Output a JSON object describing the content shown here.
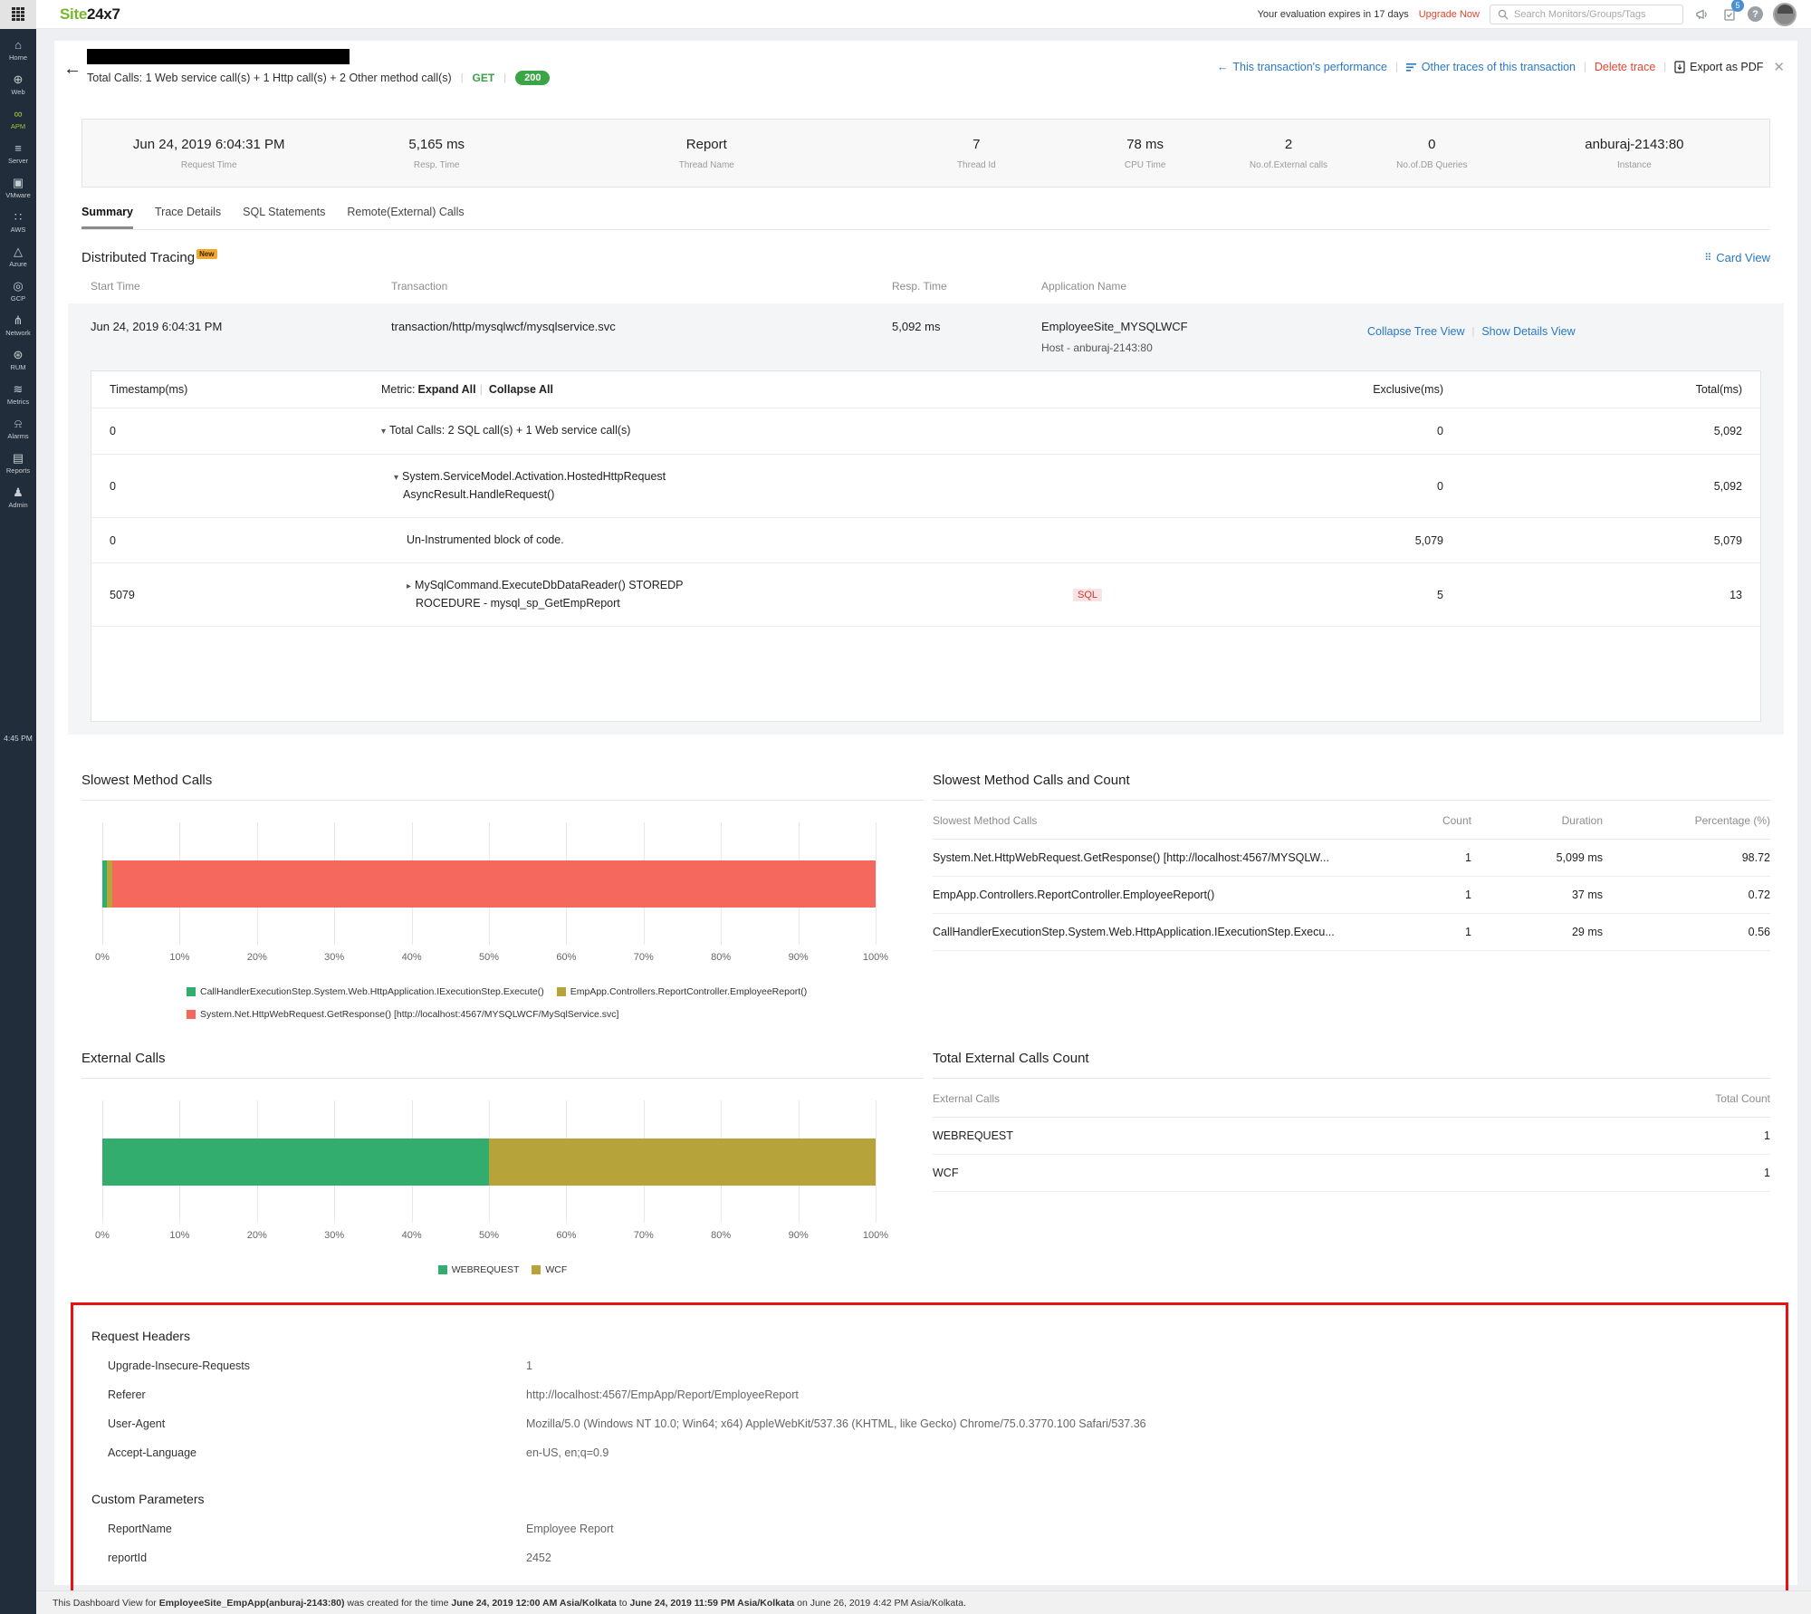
{
  "topbar": {
    "logo_site": "Site",
    "logo_rest": "24x7",
    "evaluation_text": "Your evaluation expires in 17 days",
    "upgrade_label": "Upgrade Now",
    "search_placeholder": "Search Monitors/Groups/Tags",
    "notification_count": "5"
  },
  "sidebar": {
    "time": "4:45 PM",
    "items": [
      {
        "label": "Home",
        "icon": "home-icon",
        "active": false
      },
      {
        "label": "Web",
        "icon": "web-icon",
        "active": false
      },
      {
        "label": "APM",
        "icon": "apm-icon",
        "active": true
      },
      {
        "label": "Server",
        "icon": "server-icon",
        "active": false
      },
      {
        "label": "VMware",
        "icon": "vmware-icon",
        "active": false
      },
      {
        "label": "AWS",
        "icon": "aws-icon",
        "active": false
      },
      {
        "label": "Azure",
        "icon": "azure-icon",
        "active": false
      },
      {
        "label": "GCP",
        "icon": "gcp-icon",
        "active": false
      },
      {
        "label": "Network",
        "icon": "network-icon",
        "active": false
      },
      {
        "label": "RUM",
        "icon": "rum-icon",
        "active": false
      },
      {
        "label": "Metrics",
        "icon": "metrics-icon",
        "active": false
      },
      {
        "label": "Alarms",
        "icon": "alarms-icon",
        "active": false
      },
      {
        "label": "Reports",
        "icon": "reports-icon",
        "active": false
      },
      {
        "label": "Admin",
        "icon": "admin-icon",
        "active": false
      }
    ]
  },
  "header": {
    "total_calls": "Total Calls: 1 Web service call(s) + 1 Http call(s) + 2 Other method call(s)",
    "method": "GET",
    "status_code": "200",
    "links": {
      "performance": "This transaction's performance",
      "other_traces": "Other traces of this transaction",
      "delete_trace": "Delete trace",
      "export_pdf": "Export as PDF"
    }
  },
  "stats": [
    {
      "value": "Jun 24, 2019 6:04:31 PM",
      "label": "Request Time"
    },
    {
      "value": "5,165 ms",
      "label": "Resp. Time"
    },
    {
      "value": "Report",
      "label": "Thread Name"
    },
    {
      "value": "7",
      "label": "Thread Id"
    },
    {
      "value": "78 ms",
      "label": "CPU Time"
    },
    {
      "value": "2",
      "label": "No.of.External calls"
    },
    {
      "value": "0",
      "label": "No.of.DB Queries"
    },
    {
      "value": "anburaj-2143:80",
      "label": "Instance"
    }
  ],
  "tabs": [
    {
      "label": "Summary",
      "active": true
    },
    {
      "label": "Trace Details",
      "active": false
    },
    {
      "label": "SQL Statements",
      "active": false
    },
    {
      "label": "Remote(External) Calls",
      "active": false
    }
  ],
  "tracing": {
    "title": "Distributed Tracing",
    "new_badge": "New",
    "card_view": "Card View",
    "columns": [
      "Start Time",
      "Transaction",
      "Resp. Time",
      "Application Name",
      ""
    ],
    "row": {
      "start_time": "Jun 24, 2019 6:04:31 PM",
      "transaction": "transaction/http/mysqlwcf/mysqlservice.svc",
      "resp_time": "5,092 ms",
      "application": "EmployeeSite_MYSQLWCF",
      "host": "Host - anburaj-2143:80",
      "collapse_link": "Collapse Tree View",
      "details_link": "Show Details View"
    },
    "tree": {
      "timestamp_header": "Timestamp(ms)",
      "metric_header": "Metric:",
      "expand_all": "Expand All",
      "collapse_all": "Collapse All",
      "exclusive_header": "Exclusive(ms)",
      "total_header": "Total(ms)",
      "rows": [
        {
          "timestamp": "0",
          "arrow": "▾",
          "indent": 0,
          "lines": [
            "Total Calls: 2 SQL call(s) + 1 Web service call(s)"
          ],
          "tag": "",
          "exclusive": "0",
          "total": "5,092"
        },
        {
          "timestamp": "0",
          "arrow": "▾",
          "indent": 1,
          "lines": [
            "System.ServiceModel.Activation.HostedHttpRequest",
            "AsyncResult.HandleRequest()"
          ],
          "tag": "",
          "exclusive": "0",
          "total": "5,092"
        },
        {
          "timestamp": "0",
          "arrow": "",
          "indent": 2,
          "lines": [
            "Un-Instrumented block of code."
          ],
          "tag": "",
          "exclusive": "5,079",
          "total": "5,079"
        },
        {
          "timestamp": "5079",
          "arrow": "▸",
          "indent": 2,
          "lines": [
            "MySqlCommand.ExecuteDbDataReader() STOREDP",
            "ROCEDURE - mysql_sp_GetEmpReport"
          ],
          "tag": "SQL",
          "exclusive": "5",
          "total": "13"
        }
      ]
    }
  },
  "slowest_table": {
    "title": "Slowest Method Calls and Count",
    "columns": [
      "Slowest Method Calls",
      "Count",
      "Duration",
      "Percentage (%)"
    ],
    "rows": [
      {
        "method": "System.Net.HttpWebRequest.GetResponse() [http://localhost:4567/MYSQLW...",
        "count": "1",
        "duration": "5,099 ms",
        "percentage": "98.72"
      },
      {
        "method": "EmpApp.Controllers.ReportController.EmployeeReport()",
        "count": "1",
        "duration": "37 ms",
        "percentage": "0.72"
      },
      {
        "method": "CallHandlerExecutionStep.System.Web.HttpApplication.IExecutionStep.Execu...",
        "count": "1",
        "duration": "29 ms",
        "percentage": "0.56"
      }
    ]
  },
  "external_table": {
    "title": "Total External Calls Count",
    "columns": [
      "External Calls",
      "Total Count"
    ],
    "rows": [
      {
        "name": "WEBREQUEST",
        "count": "1"
      },
      {
        "name": "WCF",
        "count": "1"
      }
    ]
  },
  "request_headers": {
    "title": "Request Headers",
    "rows": [
      {
        "label": "Upgrade-Insecure-Requests",
        "value": "1"
      },
      {
        "label": "Referer",
        "value": "http://localhost:4567/EmpApp/Report/EmployeeReport"
      },
      {
        "label": "User-Agent",
        "value": "Mozilla/5.0 (Windows NT 10.0; Win64; x64) AppleWebKit/537.36 (KHTML, like Gecko) Chrome/75.0.3770.100 Safari/537.36"
      },
      {
        "label": "Accept-Language",
        "value": "en-US, en;q=0.9"
      }
    ]
  },
  "custom_parameters": {
    "title": "Custom Parameters",
    "rows": [
      {
        "label": "ReportName",
        "value": "Employee Report"
      },
      {
        "label": "reportId",
        "value": "2452"
      }
    ]
  },
  "footer": {
    "segments": [
      {
        "text": "This Dashboard View for ",
        "bold": false
      },
      {
        "text": "EmployeeSite_EmpApp(anburaj-2143:80)",
        "bold": true
      },
      {
        "text": " was created for the time ",
        "bold": false
      },
      {
        "text": "June 24, 2019 12:00 AM Asia/Kolkata",
        "bold": true
      },
      {
        "text": " to ",
        "bold": false
      },
      {
        "text": "June 24, 2019 11:59 PM Asia/Kolkata",
        "bold": true
      },
      {
        "text": " on June 26, 2019 4:42 PM Asia/Kolkata.",
        "bold": false
      }
    ]
  },
  "colors": {
    "accent_blue": "#2878c8",
    "brand_green": "#76b82a",
    "status_green": "#3aa545",
    "alert_red": "#e8442d",
    "annotation_red": "#e91212",
    "new_badge_orange": "#f2a72e",
    "chart_green": "#33ad6d",
    "chart_olive": "#b6a339",
    "chart_red": "#f4685e"
  },
  "chart_data": [
    {
      "type": "bar",
      "orientation": "horizontal",
      "stacked": true,
      "title": "Slowest Method Calls",
      "unit": "percent",
      "xlim": [
        0,
        100
      ],
      "x_ticks": [
        "0%",
        "10%",
        "20%",
        "30%",
        "40%",
        "50%",
        "60%",
        "70%",
        "80%",
        "90%",
        "100%"
      ],
      "grid": true,
      "legend_position": "bottom",
      "legend_align": "left",
      "series": [
        {
          "name": "CallHandlerExecutionStep.System.Web.HttpApplication.IExecutionStep.Execute()",
          "value": 0.56,
          "color": "#33ad6d"
        },
        {
          "name": "EmpApp.Controllers.ReportController.EmployeeReport()",
          "value": 0.72,
          "color": "#b6a339"
        },
        {
          "name": "System.Net.HttpWebRequest.GetResponse() [http://localhost:4567/MYSQLWCF/MySqlService.svc]",
          "value": 98.72,
          "color": "#f4685e"
        }
      ],
      "legend_rows": [
        [
          0,
          1
        ],
        [
          2
        ]
      ]
    },
    {
      "type": "bar",
      "orientation": "horizontal",
      "stacked": true,
      "title": "External Calls",
      "unit": "percent",
      "xlim": [
        0,
        100
      ],
      "x_ticks": [
        "0%",
        "10%",
        "20%",
        "30%",
        "40%",
        "50%",
        "60%",
        "70%",
        "80%",
        "90%",
        "100%"
      ],
      "grid": true,
      "legend_position": "bottom",
      "legend_align": "center",
      "series": [
        {
          "name": "WEBREQUEST",
          "value": 50,
          "color": "#33ad6d"
        },
        {
          "name": "WCF",
          "value": 50,
          "color": "#b6a339"
        }
      ],
      "legend_rows": [
        [
          0,
          1
        ]
      ]
    }
  ]
}
